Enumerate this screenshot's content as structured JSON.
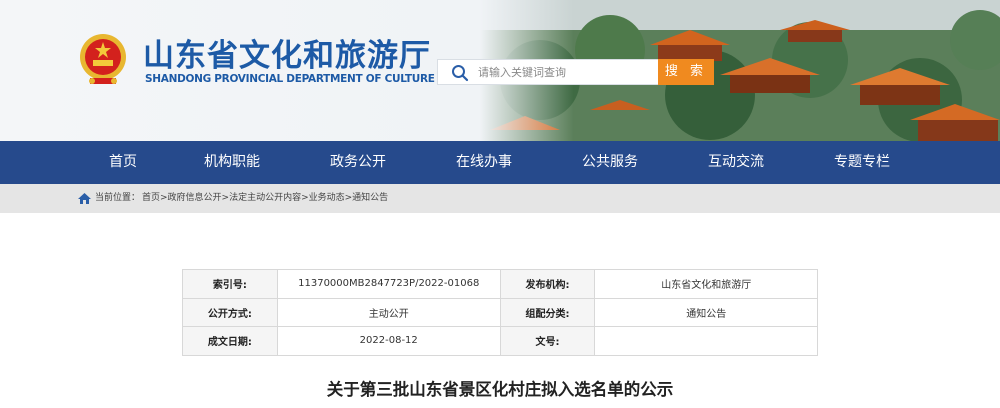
{
  "site": {
    "title": "山东省文化和旅游厅",
    "subtitle": "SHANDONG PROVINCIAL DEPARTMENT OF CULTURE AND TOURISM",
    "emblem_icon": "national-emblem",
    "brand_color": "#1d5aa6"
  },
  "search": {
    "placeholder": "请输入关键词查询",
    "button_label": "搜 索",
    "button_color": "#f08a1f"
  },
  "nav": {
    "color": "#264a8c",
    "items": [
      {
        "label": "首页"
      },
      {
        "label": "机构职能"
      },
      {
        "label": "政务公开"
      },
      {
        "label": "在线办事"
      },
      {
        "label": "公共服务"
      },
      {
        "label": "互动交流"
      },
      {
        "label": "专题专栏"
      }
    ]
  },
  "breadcrumb": {
    "label": "当前位置：",
    "path": "首页>政府信息公开>法定主动公开内容>业务动态>通知公告"
  },
  "info": {
    "index_label": "索引号:",
    "index_value": "11370000MB2847723P/2022-01068",
    "publisher_label": "发布机构:",
    "publisher_value": "山东省文化和旅游厅",
    "disclosure_label": "公开方式:",
    "disclosure_value": "主动公开",
    "category_label": "组配分类:",
    "category_value": "通知公告",
    "date_label": "成文日期:",
    "date_value": "2022-08-12",
    "docno_label": "文号:",
    "docno_value": ""
  },
  "article": {
    "title": "关于第三批山东省景区化村庄拟入选名单的公示"
  }
}
